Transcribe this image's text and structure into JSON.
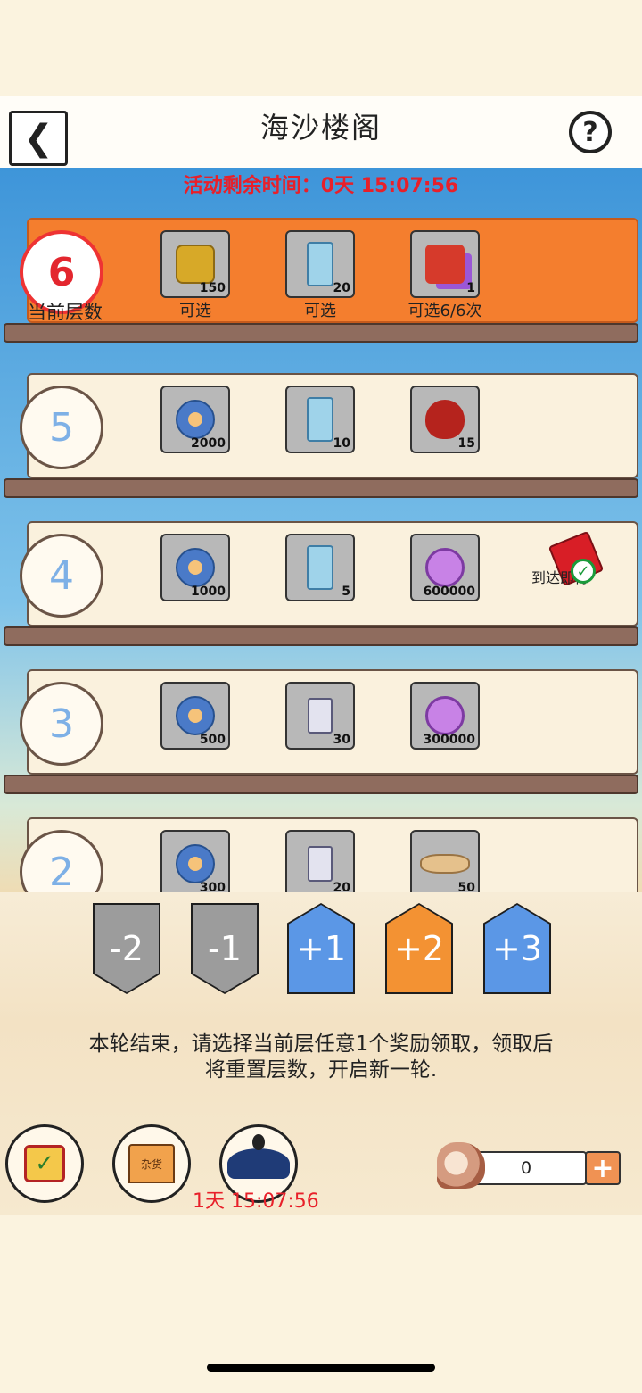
{
  "header": {
    "title": "海沙楼阁",
    "back_icon": "back-arrow-icon",
    "help_label": "?"
  },
  "activity_timer": "活动剩余时间：0天 15:07:56",
  "current_floor": {
    "number": "6",
    "label": "当前层数",
    "items": [
      {
        "icon": "gold-token",
        "count": "150",
        "caption": "可选"
      },
      {
        "icon": "blue-ticket",
        "count": "20",
        "caption": "可选"
      },
      {
        "icon": "gift-box",
        "count": "1",
        "caption": "可选6/6次"
      }
    ]
  },
  "floors": [
    {
      "number": "5",
      "items": [
        {
          "icon": "shell",
          "count": "2000"
        },
        {
          "icon": "blue-ticket",
          "count": "10"
        },
        {
          "icon": "red-bag",
          "count": "15"
        }
      ]
    },
    {
      "number": "4",
      "items": [
        {
          "icon": "shell",
          "count": "1000"
        },
        {
          "icon": "blue-ticket",
          "count": "5"
        },
        {
          "icon": "purple-coin",
          "count": "600000"
        }
      ],
      "bonus_label": "到达即得"
    },
    {
      "number": "3",
      "items": [
        {
          "icon": "shell",
          "count": "500"
        },
        {
          "icon": "scroll",
          "count": "30"
        },
        {
          "icon": "purple-coin",
          "count": "300000"
        }
      ]
    },
    {
      "number": "2",
      "items": [
        {
          "icon": "shell",
          "count": "300"
        },
        {
          "icon": "scroll",
          "count": "20"
        },
        {
          "icon": "sand-mat",
          "count": "50"
        }
      ]
    }
  ],
  "steps": [
    "-2",
    "-1",
    "+1",
    "+2",
    "+3"
  ],
  "notice_line1": "本轮结束，请选择当前层任意1个奖励领取，领取后",
  "notice_line2": "将重置层数，开启新一轮.",
  "shop_label": "杂货",
  "event_timer": "1天 15:07:56",
  "shell_count": "0",
  "colors": {
    "accent_orange": "#f47e2e",
    "timer_red": "#e8202a",
    "plus_blue": "#5b97e6"
  }
}
